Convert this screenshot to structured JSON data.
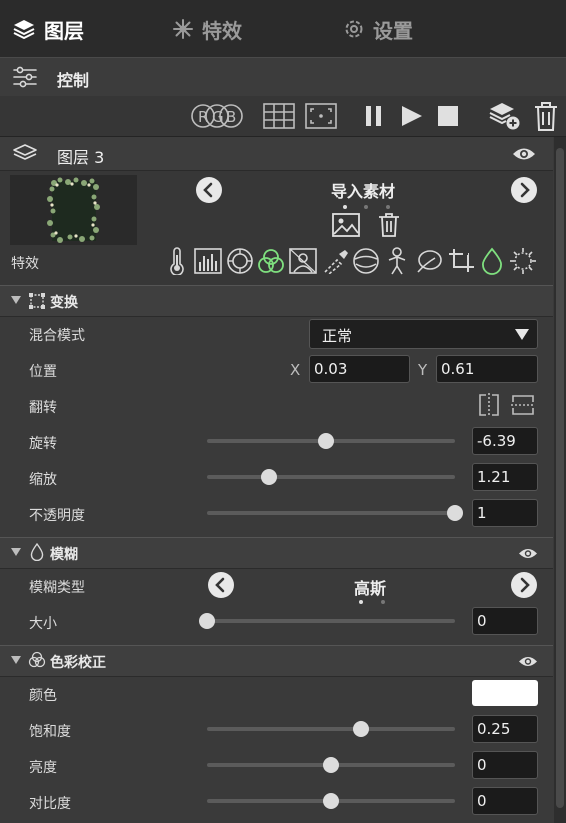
{
  "tabs": [
    {
      "label": "图层",
      "icon": "layers-icon",
      "active": true
    },
    {
      "label": "特效",
      "icon": "sparkle-icon",
      "active": false
    },
    {
      "label": "设置",
      "icon": "gear-icon",
      "active": false
    }
  ],
  "control": {
    "title": "控制",
    "icon": "sliders-icon"
  },
  "toolbar": {
    "rgb_label": "RGB",
    "icons": [
      "rgb-toggle-icon",
      "grid-icon",
      "fit-frame-icon",
      "pause-icon",
      "play-icon",
      "stop-icon",
      "add-layer-icon",
      "trash-icon"
    ]
  },
  "layer": {
    "title": "图层 3",
    "import_label": "导入素材",
    "effects_label": "特效",
    "effect_icons": [
      "temperature-icon",
      "levels-icon",
      "vignette-icon",
      "color-channels-icon",
      "image-adjust-icon",
      "eyedropper-icon",
      "sphere-icon",
      "figure-icon",
      "leaf-icon",
      "crop-icon",
      "blur-drop-icon",
      "sun-noise-icon"
    ]
  },
  "transform": {
    "title": "变换",
    "blend_label": "混合模式",
    "blend_value": "正常",
    "position_label": "位置",
    "x_label": "X",
    "x_value": "0.03",
    "y_label": "Y",
    "y_value": "0.61",
    "flip_label": "翻转",
    "rotate_label": "旋转",
    "rotate_value": "-6.39",
    "rotate_level": 0.48,
    "scale_label": "缩放",
    "scale_value": "1.21",
    "scale_level": 0.25,
    "opacity_label": "不透明度",
    "opacity_value": "1",
    "opacity_level": 1.0
  },
  "blur": {
    "title": "模糊",
    "type_label": "模糊类型",
    "type_value": "高斯",
    "size_label": "大小",
    "size_value": "0",
    "size_level": 0.0
  },
  "color": {
    "title": "色彩校正",
    "color_label": "颜色",
    "swatch": "#ffffff",
    "saturation_label": "饱和度",
    "saturation_value": "0.25",
    "saturation_level": 0.62,
    "brightness_label": "亮度",
    "brightness_value": "0",
    "brightness_level": 0.5,
    "contrast_label": "对比度",
    "contrast_value": "0",
    "contrast_level": 0.5
  },
  "colors": {
    "accent_green": "#7fe07f",
    "panel_bg": "#3a3a3a"
  }
}
